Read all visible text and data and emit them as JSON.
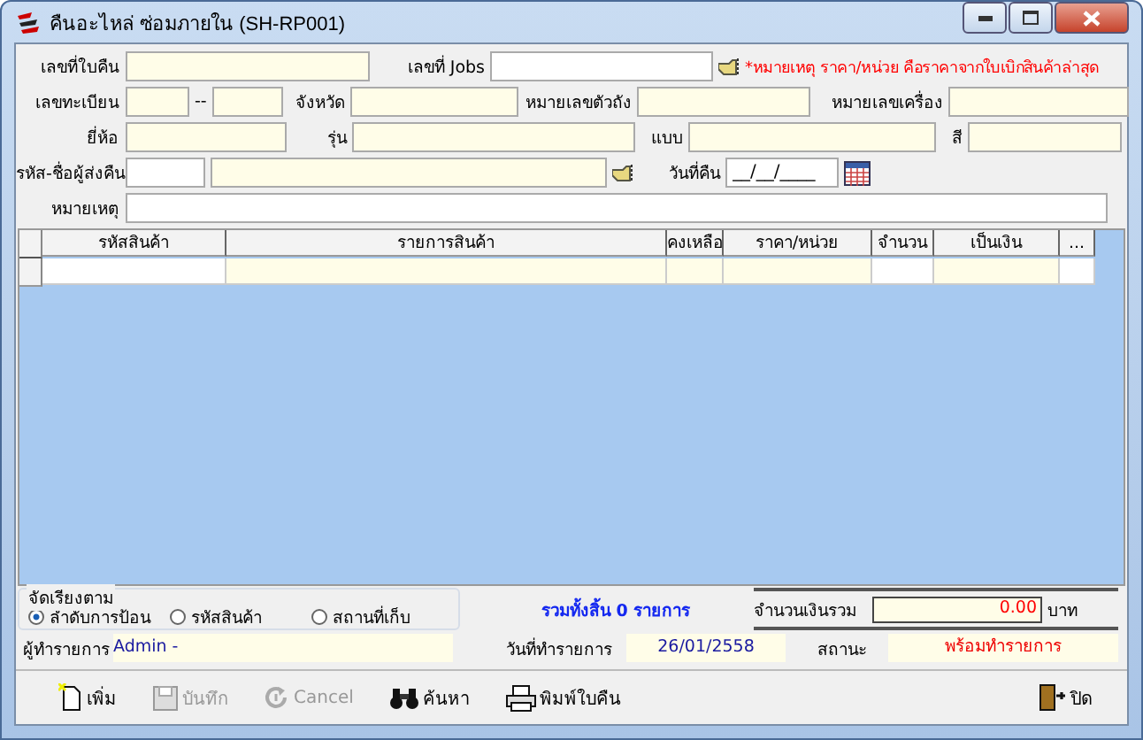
{
  "window": {
    "title": "คืนอะไหล่ ซ่อมภายใน (SH-RP001)"
  },
  "form": {
    "return_no": {
      "label": "เลขที่ใบคืน"
    },
    "jobs": {
      "label": "เลขที่ Jobs"
    },
    "note": "*หมายเหตุ ราคา/หน่วย คือราคาจากใบเบิกสินค้าล่าสุด",
    "registration": {
      "label": "เลขทะเบียน",
      "separator": "--"
    },
    "province": {
      "label": "จังหวัด"
    },
    "chassis": {
      "label": "หมายเลขตัวถัง"
    },
    "engine": {
      "label": "หมายเลขเครื่อง"
    },
    "brand": {
      "label": "ยี่ห้อ"
    },
    "model": {
      "label": "รุ่น"
    },
    "type": {
      "label": "แบบ"
    },
    "paint": {
      "label": "สี"
    },
    "returner": {
      "label": "รหัส-ชื่อผู้ส่งคืน"
    },
    "return_date": {
      "label": "วันที่คืน",
      "value": "__/__/____"
    },
    "remark": {
      "label": "หมายเหตุ"
    }
  },
  "table": {
    "columns": [
      "รหัสสินค้า",
      "รายการสินค้า",
      "คงเหลือ",
      "ราคา/หน่วย",
      "จำนวน",
      "เป็นเงิน",
      "..."
    ]
  },
  "sort": {
    "label": "จัดเรียงตาม",
    "options": [
      {
        "label": "ลำดับการป้อน",
        "selected": true
      },
      {
        "label": "รหัสสินค้า",
        "selected": false
      },
      {
        "label": "สถานที่เก็บ",
        "selected": false
      }
    ]
  },
  "summary": "รวมทั้งสิ้น 0 รายการ",
  "total": {
    "label": "จำนวนเงินรวม",
    "value": "0.00",
    "unit": "บาท"
  },
  "operator": {
    "label": "ผู้ทำรายการ",
    "value": "Admin -"
  },
  "date": {
    "label": "วันที่ทำรายการ",
    "value": "26/01/2558"
  },
  "status": {
    "label": "สถานะ",
    "value": "พร้อมทำรายการ"
  },
  "toolbar": [
    {
      "label": "เพิ่ม",
      "kind": "new",
      "disabled": false
    },
    {
      "label": "บันทึก",
      "kind": "save",
      "disabled": true
    },
    {
      "label": "Cancel",
      "kind": "cancel",
      "disabled": true
    },
    {
      "label": "ค้นหา",
      "kind": "search",
      "disabled": false
    },
    {
      "label": "พิมพ์ใบคืน",
      "kind": "print",
      "disabled": false
    },
    {
      "label": "ปิด",
      "kind": "exit",
      "disabled": false
    }
  ]
}
